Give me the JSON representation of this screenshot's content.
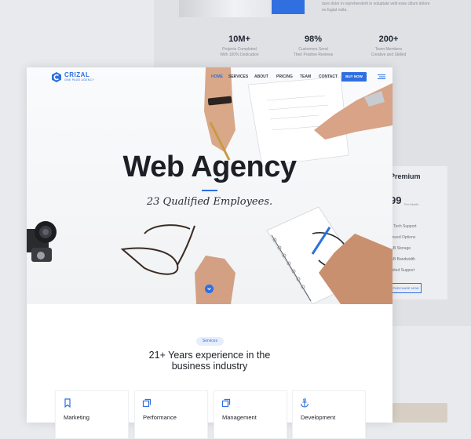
{
  "background_page": {
    "blurb_lines": [
      "dure dolor in reprehenderit in voluptate velit esse cillum dolore",
      "eu fugiat nulla."
    ],
    "stats": [
      {
        "value": "10M+",
        "caption_lines": [
          "Projects Completed",
          "With 100% Dedication"
        ]
      },
      {
        "value": "98%",
        "caption_lines": [
          "Customers Send",
          "Their Positive Reviews"
        ]
      },
      {
        "value": "200+",
        "caption_lines": [
          "Team Members",
          "Creative and Skilled"
        ]
      }
    ],
    "pricing": {
      "title": "Premium",
      "amount": "99",
      "period": "Per Month",
      "features": [
        "7 Tech Support",
        "anced Options",
        "GB Storage",
        "GB Bandwidth",
        "mited Support"
      ],
      "button": "PURCHASE NOW"
    }
  },
  "nav": {
    "brand": "CRIZAL",
    "tagline": "ONE PAGE AGENCY",
    "items": [
      "HOME",
      "SERVICES",
      "ABOUT",
      "PRICING",
      "TEAM",
      "CONTACT"
    ],
    "active_index": 0,
    "buy_label": "BUY NOW"
  },
  "hero": {
    "headline": "Web Agency",
    "subline": "23 Qualified Employees."
  },
  "services": {
    "pill": "Services",
    "heading_lines": [
      "21+ Years experience in the",
      "business industry"
    ],
    "cards": [
      {
        "label": "Marketing",
        "icon": "bookmark-icon"
      },
      {
        "label": "Performance",
        "icon": "copy-icon"
      },
      {
        "label": "Management",
        "icon": "copy-icon"
      },
      {
        "label": "Development",
        "icon": "anchor-icon"
      }
    ]
  },
  "colors": {
    "accent": "#2f6fe0",
    "text": "#1c1f26"
  }
}
